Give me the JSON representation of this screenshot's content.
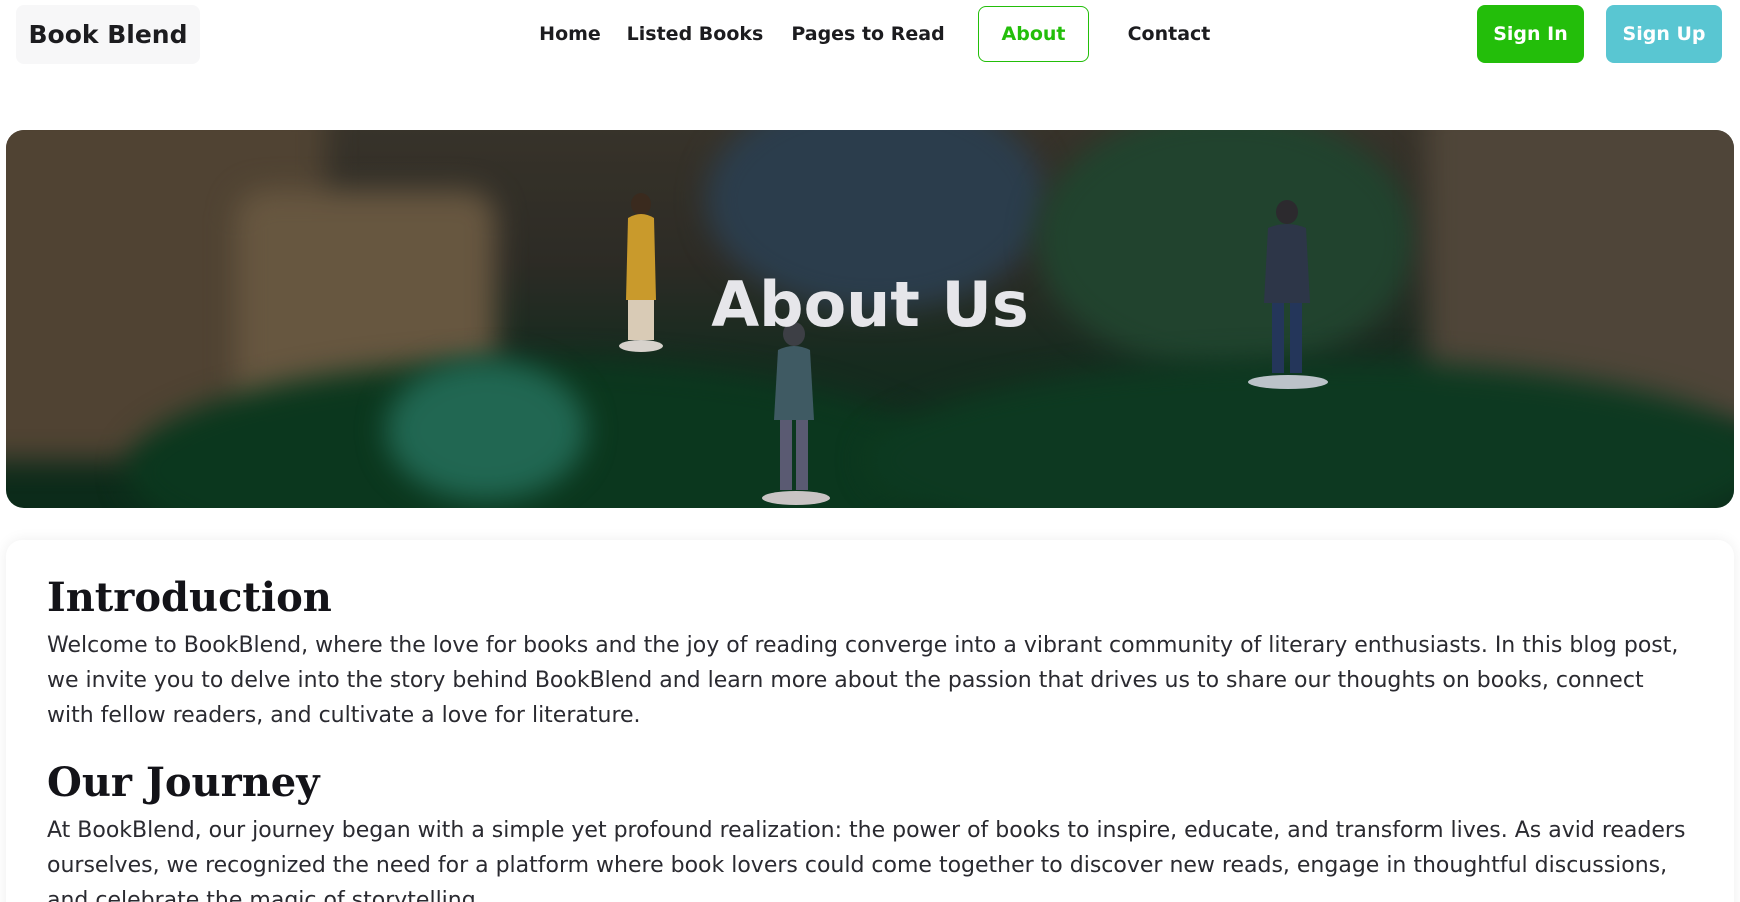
{
  "brand": {
    "name": "Book Blend"
  },
  "nav": {
    "items": [
      {
        "label": "Home",
        "active": false
      },
      {
        "label": "Listed Books",
        "active": false
      },
      {
        "label": "Pages to Read",
        "active": false
      },
      {
        "label": "About",
        "active": true
      },
      {
        "label": "Contact",
        "active": false
      }
    ]
  },
  "auth": {
    "signin_label": "Sign In",
    "signup_label": "Sign Up"
  },
  "colors": {
    "accent": "#23be0a",
    "signup": "#59c6d2",
    "text": "#131318"
  },
  "hero": {
    "title": "About Us"
  },
  "content": {
    "sections": [
      {
        "heading": "Introduction",
        "body": "Welcome to BookBlend, where the love for books and the joy of reading converge into a vibrant community of literary enthusiasts. In this blog post, we invite you to delve into the story behind BookBlend and learn more about the passion that drives us to share our thoughts on books, connect with fellow readers, and cultivate a love for literature."
      },
      {
        "heading": "Our Journey",
        "body": "At BookBlend, our journey began with a simple yet profound realization: the power of books to inspire, educate, and transform lives. As avid readers ourselves, we recognized the need for a platform where book lovers could come together to discover new reads, engage in thoughtful discussions, and celebrate the magic of storytelling."
      }
    ]
  }
}
